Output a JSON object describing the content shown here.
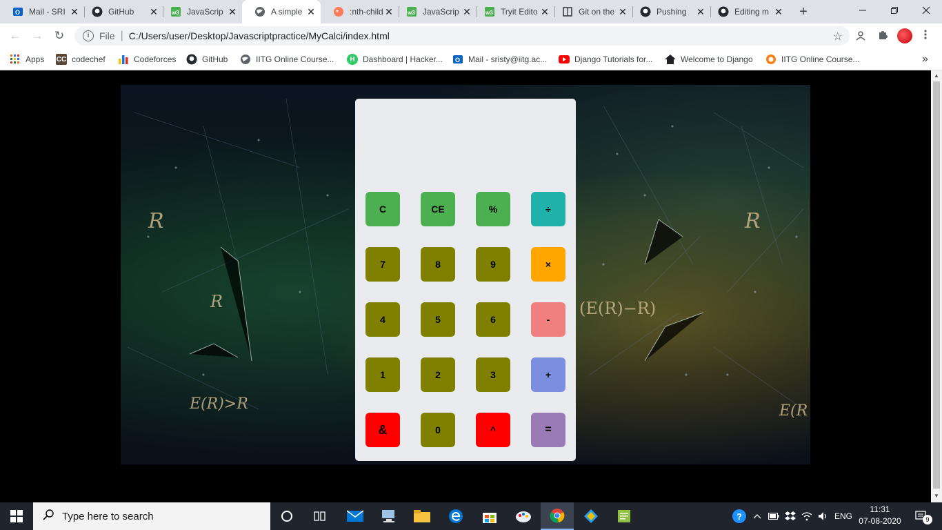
{
  "browser": {
    "tabs": [
      {
        "label": "Mail - SRI",
        "icon": "outlook-icon",
        "active": false
      },
      {
        "label": "GitHub",
        "icon": "github-icon",
        "active": false
      },
      {
        "label": "JavaScrip",
        "icon": "w3schools-icon",
        "active": false
      },
      {
        "label": "A simple",
        "icon": "globe-icon",
        "active": true
      },
      {
        "label": ":nth-child",
        "icon": "css-tricks-icon",
        "active": false
      },
      {
        "label": "JavaScrip",
        "icon": "w3schools-icon",
        "active": false
      },
      {
        "label": "Tryit Edito",
        "icon": "w3schools-icon",
        "active": false
      },
      {
        "label": "Git on the",
        "icon": "book-icon",
        "active": false
      },
      {
        "label": "Pushing",
        "icon": "github-icon",
        "active": false
      },
      {
        "label": "Editing m",
        "icon": "github-icon",
        "active": false
      }
    ],
    "tab_close_glyph": "✕",
    "new_tab_glyph": "+",
    "omnibox": {
      "scheme_label": "File",
      "url": "C:/Users/user/Desktop/Javascriptpractice/MyCalci/index.html"
    },
    "bookmarks": [
      {
        "label": "Apps",
        "icon": "apps-grid-icon"
      },
      {
        "label": "codechef",
        "icon": "codechef-icon"
      },
      {
        "label": "Codeforces",
        "icon": "codeforces-icon"
      },
      {
        "label": "GitHub",
        "icon": "github-icon"
      },
      {
        "label": "IITG Online Course...",
        "icon": "globe-icon"
      },
      {
        "label": "Dashboard | Hacker...",
        "icon": "hackerrank-icon"
      },
      {
        "label": "Mail - sristy@iitg.ac...",
        "icon": "outlook-icon"
      },
      {
        "label": "Django Tutorials for...",
        "icon": "youtube-icon"
      },
      {
        "label": "Welcome to Django",
        "icon": "home-icon"
      },
      {
        "label": "IITG Online Course...",
        "icon": "moodle-icon"
      }
    ],
    "bookmarks_overflow": "»"
  },
  "calculator": {
    "display": "",
    "keys": [
      {
        "label": "C",
        "color": "#4caf50"
      },
      {
        "label": "CE",
        "color": "#4caf50"
      },
      {
        "label": "%",
        "color": "#4caf50"
      },
      {
        "label": "÷",
        "color": "#20b2aa"
      },
      {
        "label": "7",
        "color": "#808000"
      },
      {
        "label": "8",
        "color": "#808000"
      },
      {
        "label": "9",
        "color": "#808000"
      },
      {
        "label": "×",
        "color": "#ffa500"
      },
      {
        "label": "4",
        "color": "#808000"
      },
      {
        "label": "5",
        "color": "#808000"
      },
      {
        "label": "6",
        "color": "#808000"
      },
      {
        "label": "-",
        "color": "#f08080"
      },
      {
        "label": "1",
        "color": "#808000"
      },
      {
        "label": "2",
        "color": "#808000"
      },
      {
        "label": "3",
        "color": "#808000"
      },
      {
        "label": "+",
        "color": "#7b8ee0"
      },
      {
        "label": "&",
        "color": "#ff0000"
      },
      {
        "label": "0",
        "color": "#808000"
      },
      {
        "label": "^",
        "color": "#ff0000"
      },
      {
        "label": "=",
        "color": "#9b7bb5"
      }
    ]
  },
  "taskbar": {
    "search_placeholder": "Type here to search",
    "language": "ENG",
    "time": "11:31",
    "date": "07-08-2020",
    "notification_count": "9"
  }
}
